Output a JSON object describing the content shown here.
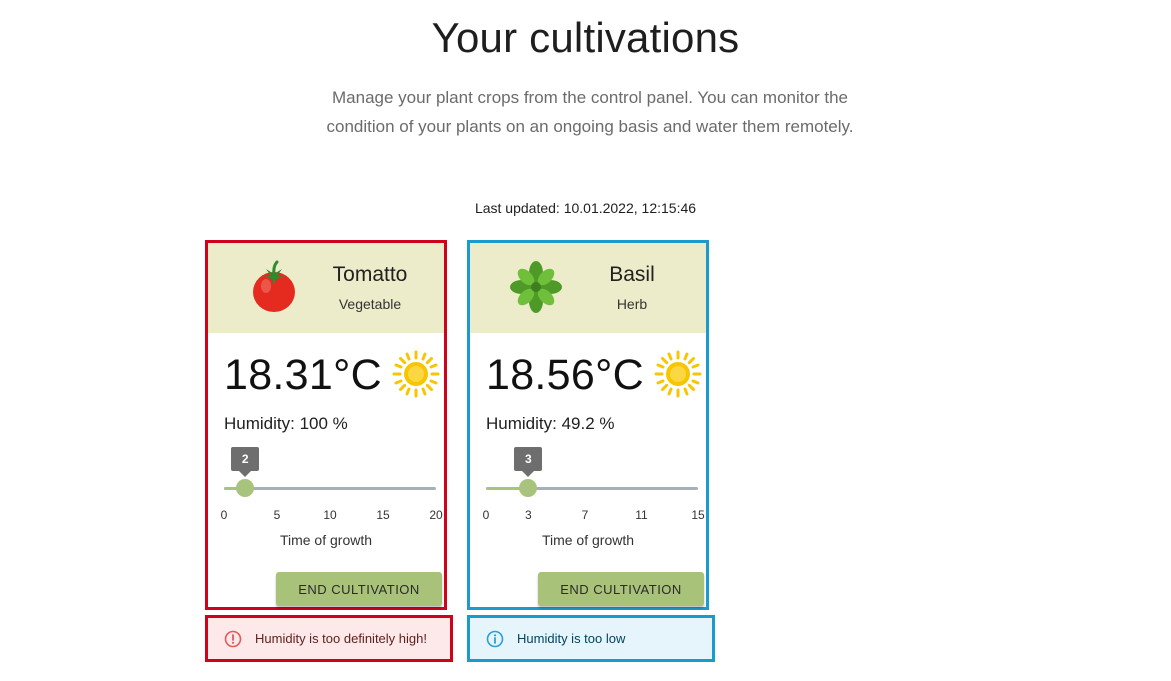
{
  "page": {
    "title": "Your cultivations",
    "description": "Manage your plant crops from the control panel. You can monitor the condition of your plants on an ongoing basis and water them remotely.",
    "last_updated": "Last updated: 10.01.2022, 12:15:46"
  },
  "colors": {
    "alert_error_border": "#d0021b",
    "alert_info_border": "#1a9bd0",
    "header_bg": "#ececcb",
    "button_bg": "#a9c27a",
    "slider_accent": "#a8c47c"
  },
  "cards": [
    {
      "name": "Tomatto",
      "type": "Vegetable",
      "icon": "tomato-icon",
      "temperature": "18.31°C",
      "weather_icon": "sun-icon",
      "humidity": "Humidity: 100 %",
      "slider": {
        "value": 2,
        "value_label": "2",
        "min": 0,
        "max": 20,
        "ticks": [
          "0",
          "5",
          "10",
          "15",
          "20"
        ],
        "tick_values": [
          0,
          5,
          10,
          15,
          20
        ]
      },
      "slider_label": "Time of growth",
      "button_label": "END CULTIVATION",
      "alert": {
        "severity": "error",
        "icon": "error-outline-icon",
        "text": "Humidity is too definitely high!"
      }
    },
    {
      "name": "Basil",
      "type": "Herb",
      "icon": "basil-icon",
      "temperature": "18.56°C",
      "weather_icon": "sun-icon",
      "humidity": "Humidity: 49.2 %",
      "slider": {
        "value": 3,
        "value_label": "3",
        "min": 0,
        "max": 15,
        "ticks": [
          "0",
          "3",
          "7",
          "11",
          "15"
        ],
        "tick_values": [
          0,
          3,
          7,
          11,
          15
        ]
      },
      "slider_label": "Time of growth",
      "button_label": "END CULTIVATION",
      "alert": {
        "severity": "info",
        "icon": "info-outline-icon",
        "text": "Humidity is too low"
      }
    }
  ]
}
